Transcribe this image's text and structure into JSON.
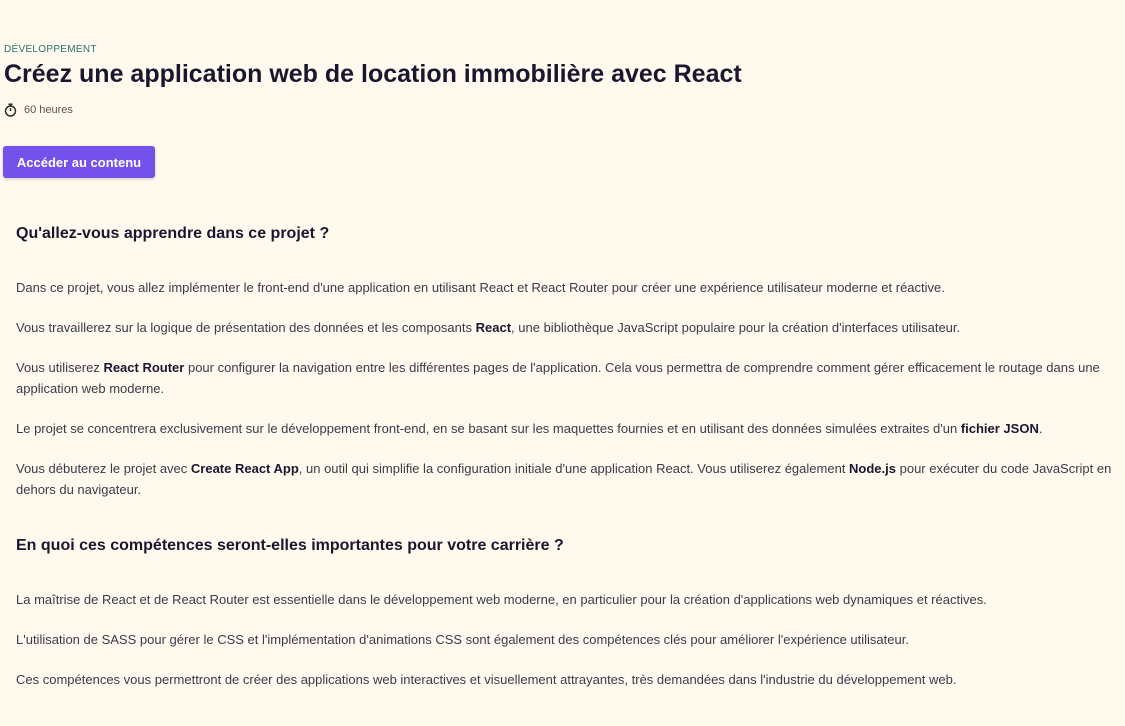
{
  "header": {
    "category": "Développement",
    "title": "Créez une application web de location immobilière avec React",
    "duration": "60 heures",
    "cta_label": "Accéder au contenu"
  },
  "section1": {
    "heading": "Qu'allez-vous apprendre dans ce projet ?",
    "p1": "Dans ce projet, vous allez implémenter le front-end d'une application en utilisant React et React Router pour créer une expérience utilisateur moderne et réactive.",
    "p2_a": "Vous travaillerez sur la logique de présentation des données et les composants ",
    "p2_b": "React",
    "p2_c": ", une bibliothèque JavaScript populaire pour la création d'interfaces utilisateur.",
    "p3_a": "Vous utiliserez ",
    "p3_b": "React Router",
    "p3_c": " pour configurer la navigation entre les différentes pages de l'application. Cela vous permettra de comprendre comment gérer efficacement le routage dans une application web moderne.",
    "p4_a": "Le projet se concentrera exclusivement sur le développement front-end, en se basant sur les maquettes fournies et en utilisant des données simulées extraites d'un ",
    "p4_b": "fichier JSON",
    "p4_c": ".",
    "p5_a": "Vous débuterez le projet avec ",
    "p5_b": "Create React App",
    "p5_c": ", un outil qui simplifie la configuration initiale d'une application React. Vous utiliserez également ",
    "p5_d": "Node.js",
    "p5_e": " pour exécuter du code JavaScript en dehors du navigateur."
  },
  "section2": {
    "heading": "En quoi ces compétences seront-elles importantes pour votre carrière ?",
    "p1": "La maîtrise de React et de React Router est essentielle dans le développement web moderne, en particulier pour la création d'applications web dynamiques et réactives.",
    "p2": "L'utilisation de SASS pour gérer le CSS et l'implémentation d'animations CSS sont également des compétences clés pour améliorer l'expérience utilisateur.",
    "p3": "Ces compétences vous permettront de créer des applications web interactives et visuellement attrayantes, très demandées dans l'industrie du développement web."
  },
  "colors": {
    "background": "#fffaed",
    "accent": "#7451eb",
    "category": "#2a6f6f"
  },
  "icons": {
    "duration": "stopwatch-icon"
  }
}
